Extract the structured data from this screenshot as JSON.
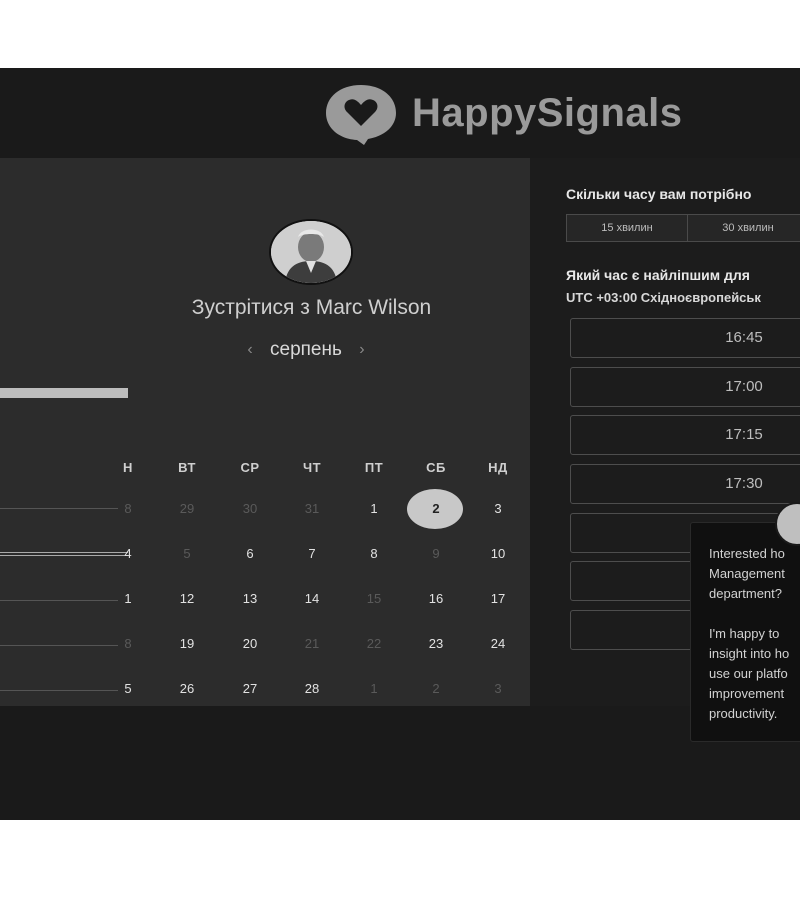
{
  "brand": {
    "name": "HappySignals",
    "logo_icon": "heart-speech-bubble-icon",
    "color": "#9a9a9a"
  },
  "host": {
    "title": "Зустрітися з Marc Wilson",
    "avatar_icon": "host-avatar"
  },
  "calendar": {
    "month": "серпень",
    "prev_icon": "chevron-left-icon",
    "next_icon": "chevron-right-icon",
    "weekdays": [
      "Н",
      "ВТ",
      "СР",
      "ЧТ",
      "ПТ",
      "СБ",
      "НД"
    ],
    "weeks": [
      [
        "8",
        "29",
        "30",
        "31",
        "1",
        "2",
        "3"
      ],
      [
        "4",
        "5",
        "6",
        "7",
        "8",
        "9",
        "10"
      ],
      [
        "1",
        "12",
        "13",
        "14",
        "15",
        "16",
        "17"
      ],
      [
        "8",
        "19",
        "20",
        "21",
        "22",
        "23",
        "24"
      ],
      [
        "5",
        "26",
        "27",
        "28",
        "1",
        "2",
        "3"
      ]
    ],
    "selected": "2"
  },
  "booking": {
    "duration_question": "Скільки часу вам потрібно",
    "durations": [
      "15 хвилин",
      "30 хвилин"
    ],
    "time_question": "Який час є найліпшим для",
    "timezone": "UTC +03:00 Східноєвропейськ",
    "slots": [
      "16:45",
      "17:00",
      "17:15",
      "17:30",
      "",
      "",
      ""
    ]
  },
  "chat": {
    "avatar_icon": "agent-avatar",
    "lines": [
      "Interested ho",
      "Management",
      "department?",
      "",
      "I'm happy to",
      "insight into ho",
      "use our platfo",
      "improvement",
      "productivity."
    ]
  },
  "colors": {
    "background": "#151515",
    "panel": "#2c2c2c",
    "selected_day": "#c8c8c8"
  }
}
